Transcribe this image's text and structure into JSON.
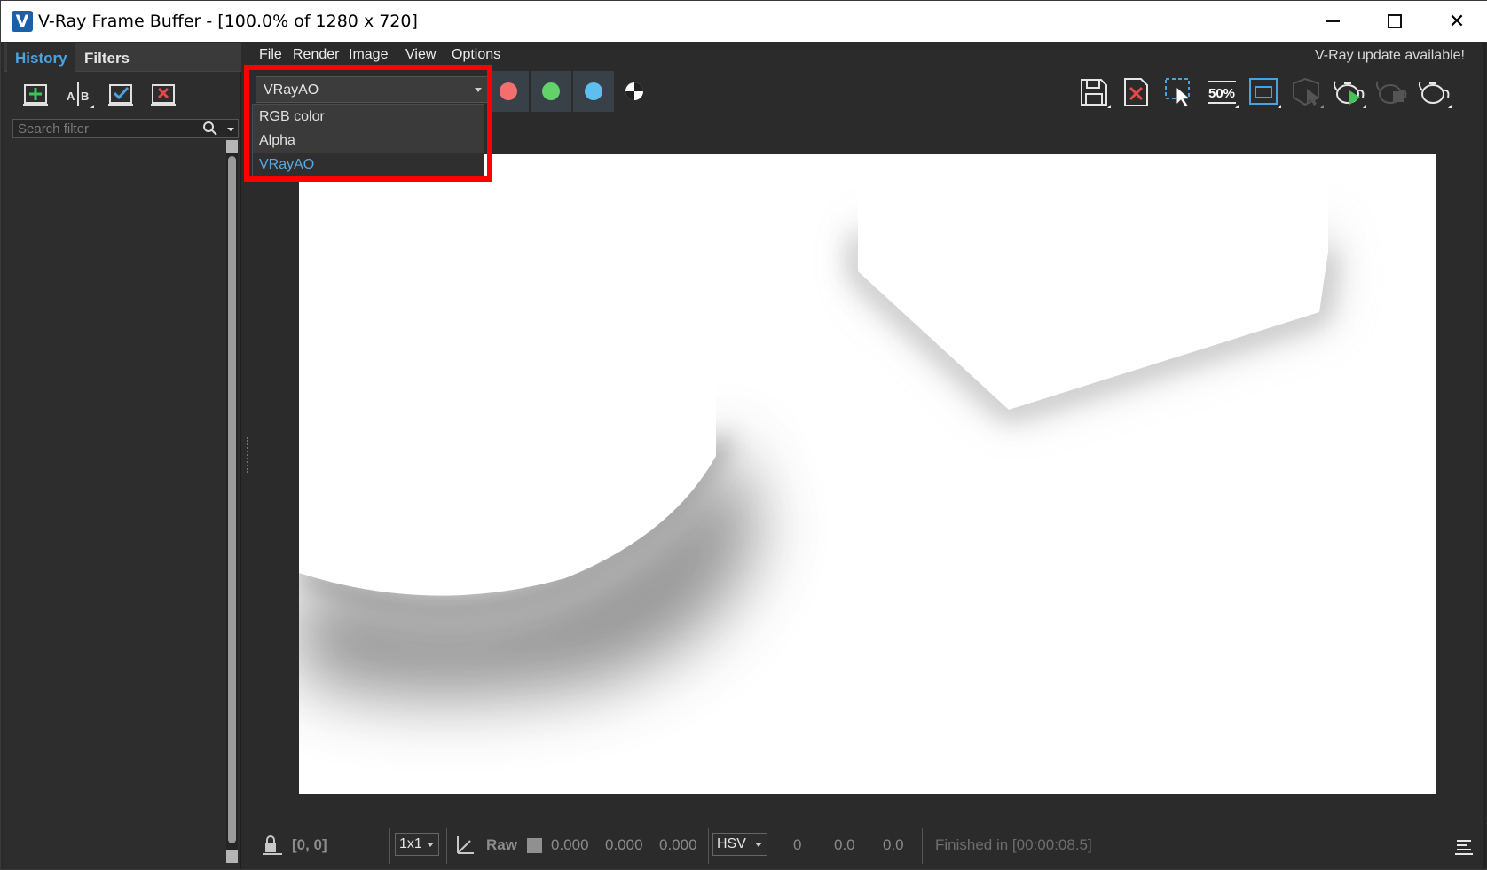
{
  "window": {
    "title": "V-Ray Frame Buffer - [100.0% of 1280 x 720]",
    "logo_letter": "V",
    "minimize_label": "minimize",
    "maximize_label": "maximize",
    "close_label": "✕"
  },
  "left_panel": {
    "tabs": [
      {
        "label": "History",
        "active": true
      },
      {
        "label": "Filters",
        "active": false
      }
    ],
    "toolbar_icons": [
      "save-to-history-icon",
      "ab-compare-icon",
      "load-history-icon",
      "clear-history-icon"
    ],
    "search": {
      "placeholder": "Search filter",
      "value": ""
    }
  },
  "menubar": {
    "items": [
      "File",
      "Render",
      "Image",
      "View",
      "Options"
    ],
    "update_notice": "V-Ray update available!"
  },
  "toolbar": {
    "channel_select": {
      "value": "VRayAO"
    },
    "channel_colors": {
      "red": "#f46e6e",
      "green": "#62d36b",
      "blue": "#5ebef0"
    },
    "right_icons": [
      "save-image-icon",
      "clear-image-icon",
      "region-render-icon",
      "zoom-50-icon",
      "render-region-frame-icon",
      "track-mouse-icon",
      "render-icon",
      "stop-render-icon",
      "render-interactive-icon"
    ],
    "zoom_label": "50%"
  },
  "channel_dropdown": {
    "options": [
      "RGB color",
      "Alpha",
      "VRayAO"
    ],
    "selected": "VRayAO"
  },
  "statusbar": {
    "coords": "[0, 0]",
    "sample_size": "1x1",
    "raw_label": "Raw",
    "rgb_values": [
      "0.000",
      "0.000",
      "0.000"
    ],
    "color_mode": "HSV",
    "hsv_values": [
      "0",
      "0.0",
      "0.0"
    ],
    "status": "Finished in [00:00:08.5]"
  },
  "colors": {
    "accent": "#4aa3df",
    "highlight": "#ff0000",
    "panel_bg": "#2b2b2b"
  }
}
